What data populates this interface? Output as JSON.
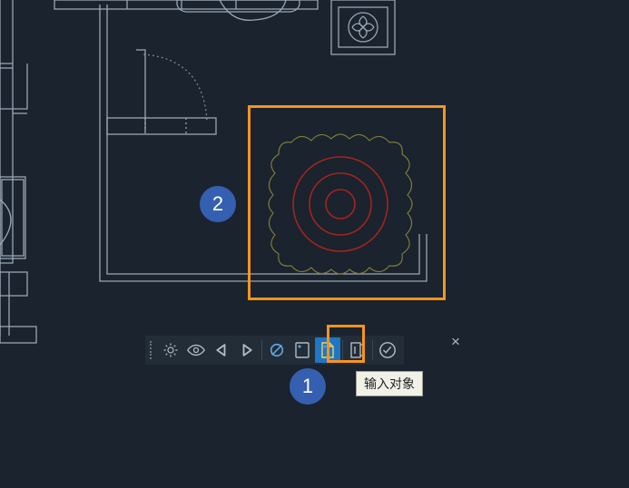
{
  "callouts": {
    "one": "1",
    "two": "2"
  },
  "tooltip": {
    "text": "输入对象"
  },
  "colors": {
    "accent_orange": "#f7941d",
    "badge_blue": "#355fb0",
    "tool_active": "#1f77c4",
    "line_gray": "#9aa7b4",
    "line_olive": "#7f7a3a",
    "line_red": "#a3241e",
    "bg": "#1a232e"
  },
  "toolbar": {
    "items": [
      {
        "name": "settings",
        "icon": "gear-icon",
        "interactable": true
      },
      {
        "name": "visibility",
        "icon": "eye-icon",
        "interactable": true
      },
      {
        "name": "nav-prev",
        "icon": "triangle-left-icon",
        "interactable": true
      },
      {
        "name": "nav-next",
        "icon": "triangle-right-icon",
        "interactable": true
      },
      {
        "name": "toggle-off",
        "icon": "circle-slash-icon",
        "interactable": true
      },
      {
        "name": "page-a",
        "icon": "document-a-icon",
        "interactable": true
      },
      {
        "name": "input-object",
        "icon": "document-corner-icon",
        "interactable": true,
        "active": true
      },
      {
        "name": "page-side",
        "icon": "document-side-icon",
        "interactable": true
      },
      {
        "name": "confirm",
        "icon": "check-circle-icon",
        "interactable": true
      }
    ],
    "close_label": "×"
  }
}
